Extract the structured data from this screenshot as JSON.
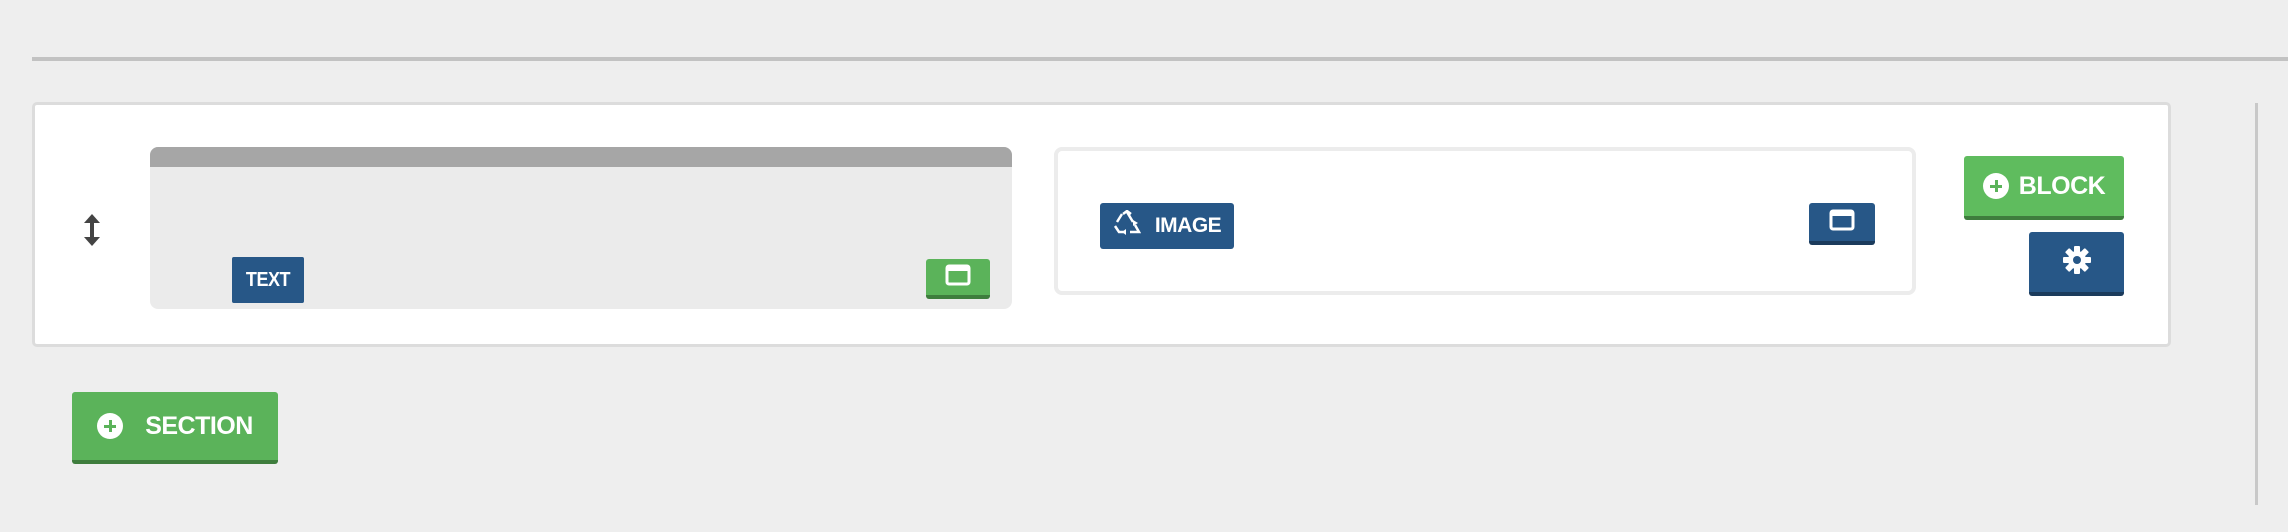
{
  "section": {
    "blocks": [
      {
        "type_label": "TEXT",
        "view_icon": "window-icon"
      },
      {
        "type_label": "IMAGE",
        "type_icon": "recycle-icon",
        "view_icon": "window-icon"
      }
    ],
    "add_block_label": "BLOCK",
    "settings_icon": "gear-icon",
    "drag_icon": "vertical-arrows-icon"
  },
  "add_section_label": "SECTION",
  "colors": {
    "primary_blue": "#275787",
    "success_green": "#5bb35a",
    "page_background": "#eeeeee"
  }
}
